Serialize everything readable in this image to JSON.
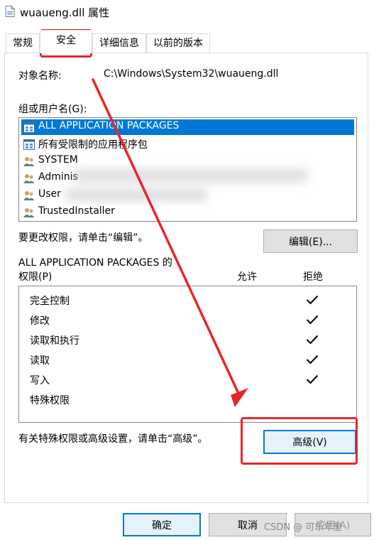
{
  "window": {
    "title": "wuaueng.dll 属性"
  },
  "tabs": [
    {
      "label": "常规"
    },
    {
      "label": "安全"
    },
    {
      "label": "详细信息"
    },
    {
      "label": "以前的版本"
    }
  ],
  "object": {
    "label": "对象名称:",
    "value": "C:\\Windows\\System32\\wuaueng.dll"
  },
  "groups": {
    "label": "组或用户名(G):",
    "items": [
      {
        "label": "ALL APPLICATION PACKAGES",
        "selected": true,
        "icon": "app-package-icon"
      },
      {
        "label": "所有受限制的应用程序包",
        "selected": false,
        "icon": "app-package-icon"
      },
      {
        "label": "SYSTEM",
        "selected": false,
        "icon": "users-icon"
      },
      {
        "label": "Adminis",
        "selected": false,
        "icon": "users-icon"
      },
      {
        "label": "User",
        "selected": false,
        "icon": "users-icon"
      },
      {
        "label": "TrustedInstaller",
        "selected": false,
        "icon": "users-icon"
      }
    ]
  },
  "change_hint": "要更改权限，请单击“编辑”。",
  "edit_button": "编辑(E)...",
  "permissions": {
    "for_label": "ALL APPLICATION PACKAGES 的",
    "label": "权限(P)",
    "allow_header": "允许",
    "deny_header": "拒绝",
    "rows": [
      {
        "name": "完全控制",
        "deny": true
      },
      {
        "name": "修改",
        "deny": true
      },
      {
        "name": "读取和执行",
        "deny": true
      },
      {
        "name": "读取",
        "deny": true
      },
      {
        "name": "写入",
        "deny": true
      },
      {
        "name": "特殊权限",
        "deny": false
      }
    ]
  },
  "advanced_hint": "有关特殊权限或高级设置，请单击“高级”。",
  "advanced_button": "高级(V)",
  "footer": {
    "ok": "确定",
    "cancel": "取消",
    "apply": "应用(A)"
  },
  "watermark": "CSDN @ 可乐年里",
  "colors": {
    "selection": "#0078d7",
    "annotation": "#e8262a"
  }
}
